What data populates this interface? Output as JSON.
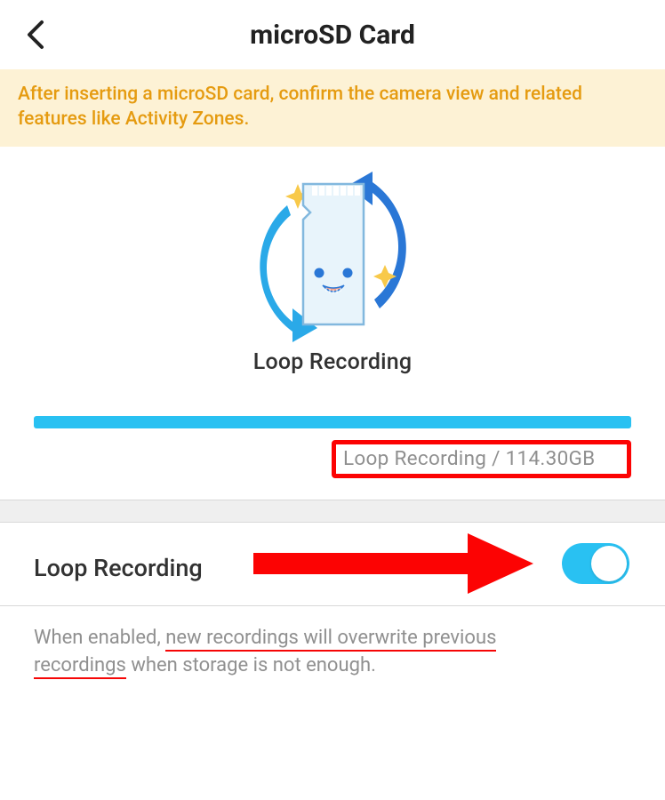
{
  "header": {
    "title": "microSD Card"
  },
  "banner": {
    "text": "After inserting a microSD card, confirm the camera view and related features like Activity Zones."
  },
  "illustration": {
    "caption": "Loop Recording"
  },
  "storage": {
    "label_and_size": "Loop Recording / 114.30GB",
    "progress_percent": 100
  },
  "setting": {
    "label": "Loop Recording",
    "enabled": true
  },
  "description": {
    "part1": "When enabled, ",
    "underlined1": "new recordings will overwrite previous",
    "underlined2": "recordings",
    "part2": " when storage is not enough."
  }
}
